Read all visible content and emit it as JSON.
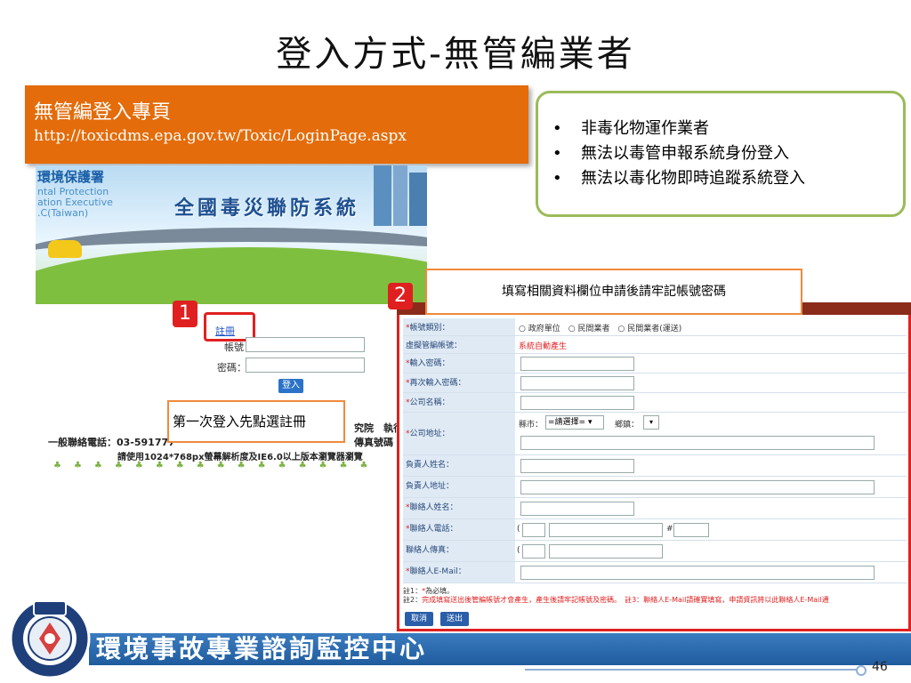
{
  "slide": {
    "title": "登入方式-無管編業者",
    "page_number": "46",
    "footer_name": "環境事故專業諮詢監控中心"
  },
  "url_box": {
    "label": "無管編登入專頁",
    "url": "http://toxicdms.epa.gov.tw/Toxic/LoginPage.aspx"
  },
  "notes": [
    "非毒化物運作業者",
    "無法以毒管申報系統身份登入",
    "無法以毒化物即時追蹤系統登入"
  ],
  "banner": {
    "org_name": "環境保護署",
    "org_sub1": "ntal Protection",
    "org_sub2": "ation Executive",
    "org_sub3": ".C(Taiwan)",
    "system_name": "全國毒災聯防系統"
  },
  "login": {
    "register_link": "註冊",
    "account_label": "帳號：",
    "password_label": "密碼：",
    "login_button": "登入",
    "contact_line": "一般聯絡電話：03-591777",
    "contact_line2": "請使用1024*768px螢幕解析度及IE6.0以上版本瀏覽器瀏覽",
    "contact_right": "究院　執行",
    "contact_right2": "傳真號碼"
  },
  "callouts": {
    "step1_number": "1",
    "step1_hint": "第一次登入先點選註冊",
    "step2_number": "2",
    "step2_hint": "填寫相關資料欄位申請後請牢記帳號密碼"
  },
  "form": {
    "account_type_label": "帳號類別：",
    "account_type_options": [
      "政府單位",
      "民間業者",
      "民間業者(運送)"
    ],
    "virtual_account_label": "虛擬管編帳號：",
    "virtual_account_value": "系統自動產生",
    "password_label": "輸入密碼：",
    "password_confirm_label": "再次輸入密碼：",
    "company_label": "公司名稱：",
    "address_label": "公司地址：",
    "county_label": "縣市：",
    "county_value": "=請選擇=",
    "township_label": "鄉鎮：",
    "owner_label": "負責人姓名：",
    "owner_address_label": "負責人地址：",
    "contact_name_label": "聯絡人姓名：",
    "contact_phone_label": "聯絡人電話：",
    "contact_fax_label": "聯絡人傳真：",
    "contact_email_label": "聯絡人E-Mail：",
    "required_mark": "*",
    "phone_sep1": "(",
    "phone_ext": "#",
    "note1_prefix": "註1：",
    "note1": "為必填。",
    "note2_prefix": "註2：",
    "note2": "完成填寫送出後管編帳號才會產生，產生後請牢記帳號及密碼。",
    "note3": "註3：聯絡人E-Mail請確實填寫，申請資訊將以此聯絡人E-Mail通",
    "cancel_button": "取消",
    "submit_button": "送出"
  },
  "colors": {
    "orange": "#e46c0a",
    "green_border": "#9bbb59",
    "red": "#e02020",
    "footer_blue": "#1f5c9e"
  }
}
